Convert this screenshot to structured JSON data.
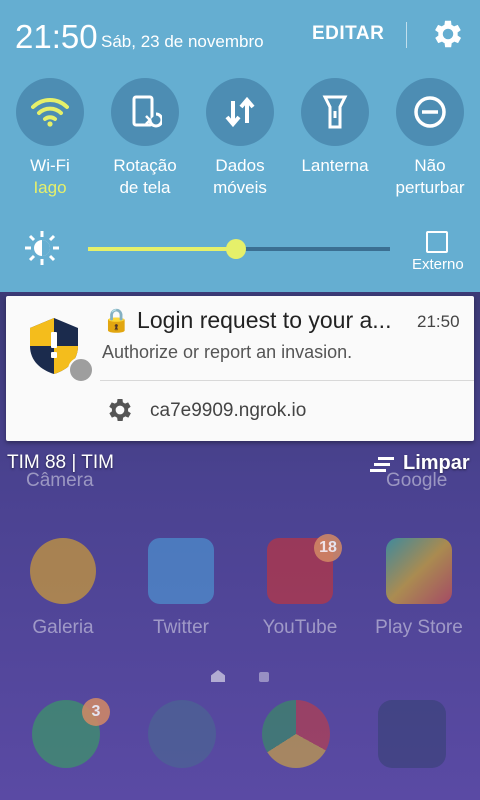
{
  "status": {
    "time": "21:50",
    "date": "Sáb, 23 de novembro",
    "edit_label": "EDITAR"
  },
  "quick_tiles": [
    {
      "label": "Wi-Fi",
      "sublabel": "Iago",
      "icon": "wifi-icon",
      "active": true
    },
    {
      "label": "Rotação\nde tela",
      "icon": "screen-rotation-icon",
      "active": false
    },
    {
      "label": "Dados\nmóveis",
      "icon": "mobile-data-icon",
      "active": false
    },
    {
      "label": "Lanterna",
      "icon": "flashlight-icon",
      "active": false
    },
    {
      "label": "Não\nperturbar",
      "icon": "do-not-disturb-icon",
      "active": false
    }
  ],
  "brightness": {
    "level": 0.49,
    "external_label": "Externo"
  },
  "notification": {
    "title": "🔒 Login request to your a...",
    "time": "21:50",
    "body": "Authorize or report an invasion.",
    "site": "ca7e9909.ngrok.io"
  },
  "footer": {
    "carrier": "TIM 88 | TIM",
    "clear_label": "Limpar"
  },
  "home": {
    "hidden_labels": [
      "Câmera",
      "Google"
    ],
    "apps": [
      {
        "name": "Galeria",
        "icon": "gallery-icon"
      },
      {
        "name": "Twitter",
        "icon": "twitter-icon"
      },
      {
        "name": "YouTube",
        "icon": "youtube-icon",
        "badge": "18"
      },
      {
        "name": "Play Store",
        "icon": "play-store-icon"
      }
    ],
    "dock": [
      {
        "icon": "whatsapp-icon",
        "badge": "3"
      },
      {
        "icon": "clock-app-icon"
      },
      {
        "icon": "chrome-icon"
      },
      {
        "icon": "app-drawer-icon"
      }
    ]
  },
  "colors": {
    "panel": "#65aed1",
    "tile": "#4d8db3",
    "accent": "#e6f06a"
  }
}
